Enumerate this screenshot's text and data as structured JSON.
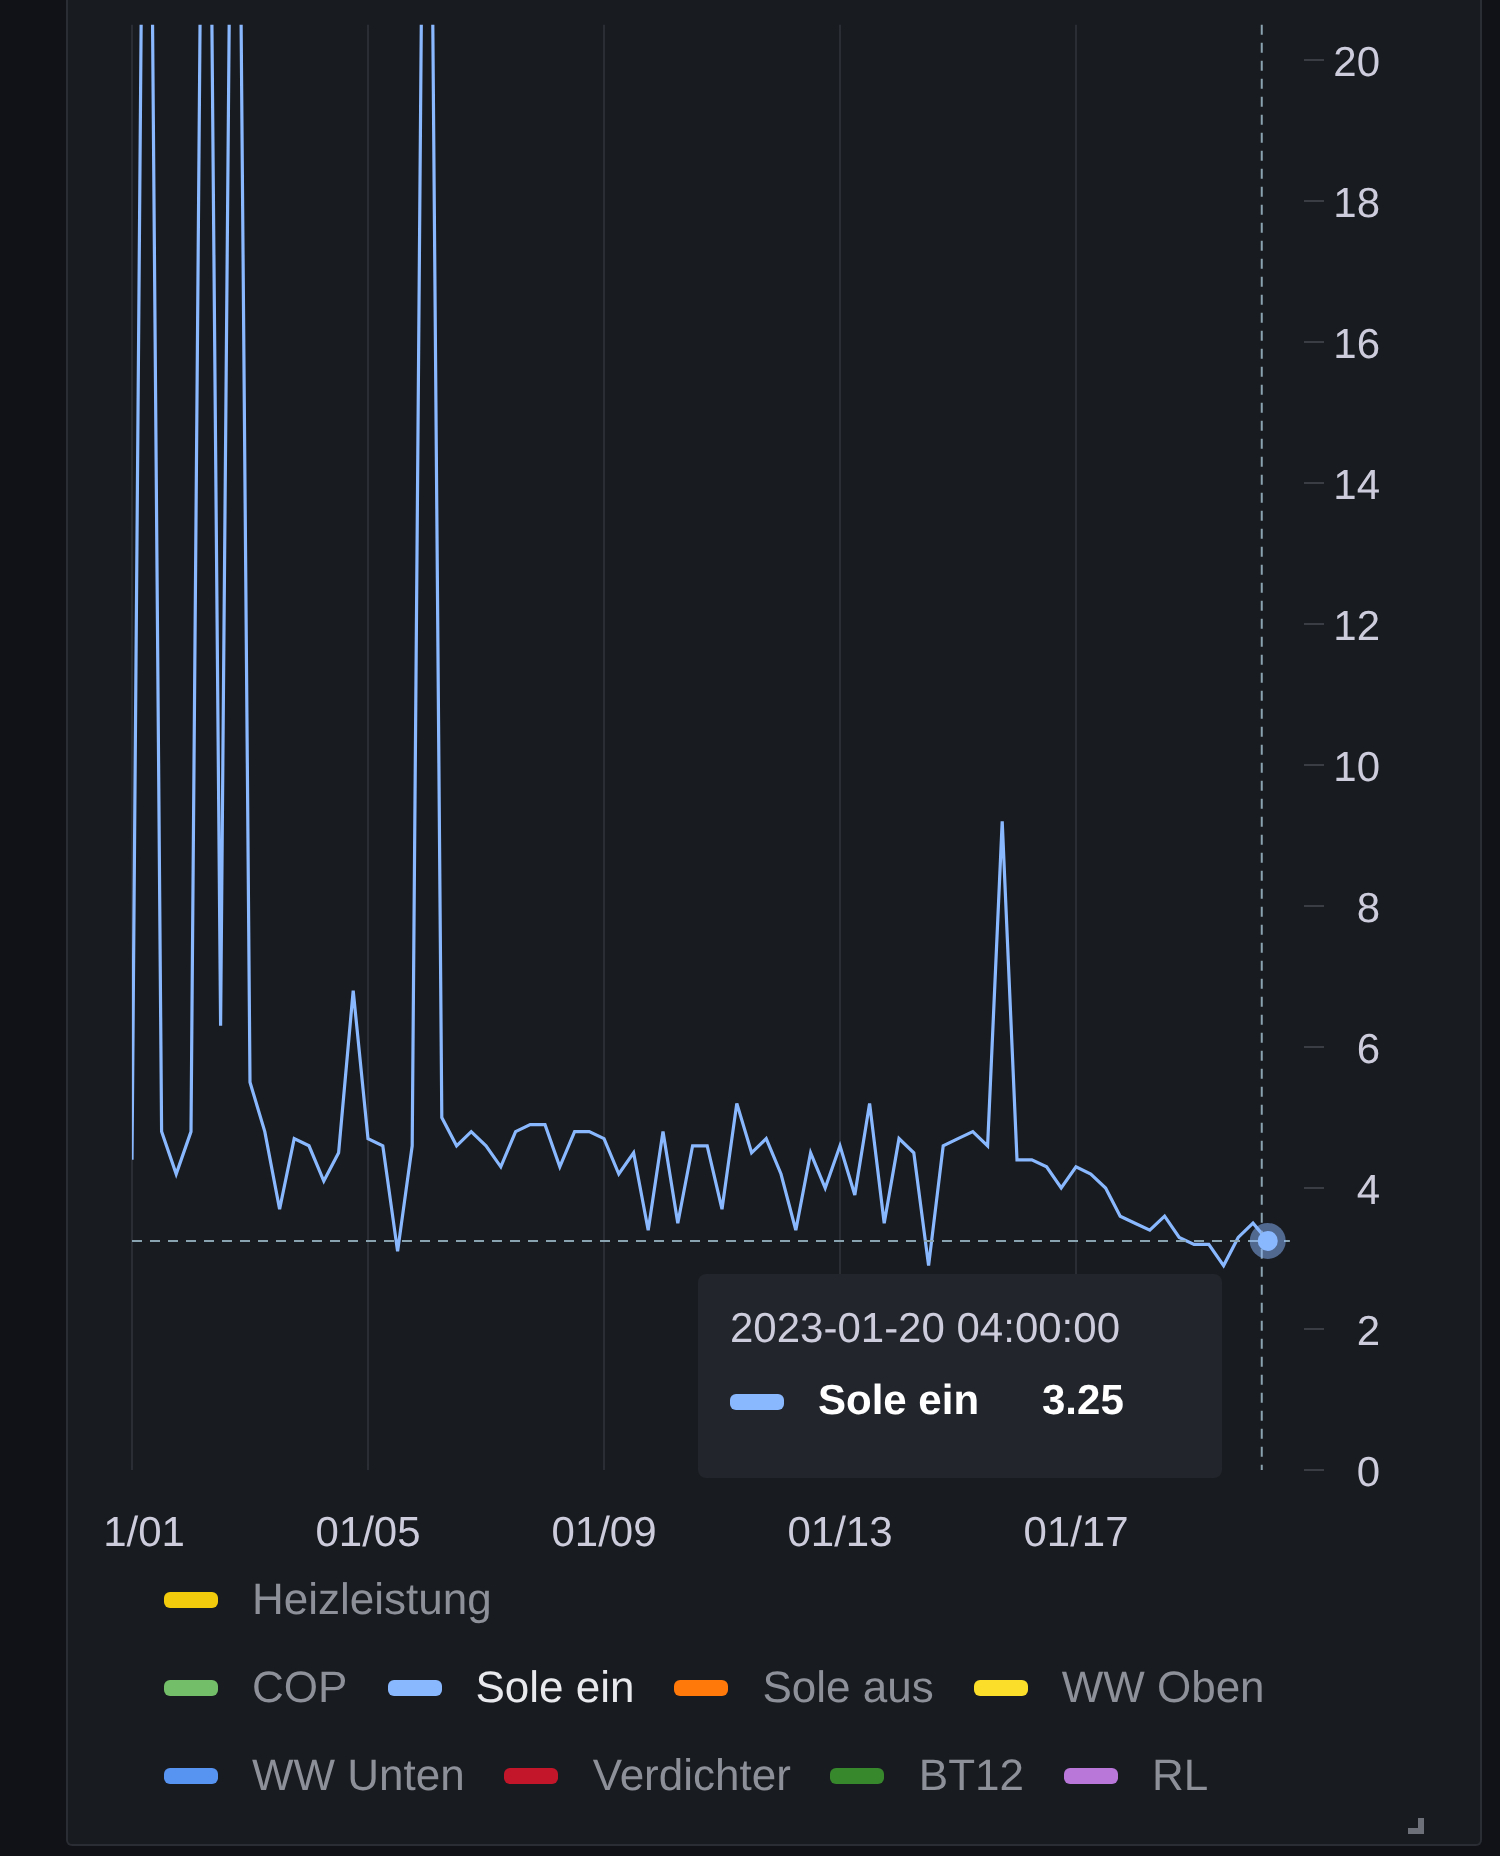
{
  "chart_data": {
    "type": "line",
    "categories": [
      "1/01",
      null,
      null,
      null,
      null,
      null,
      null,
      null,
      null,
      null,
      null,
      null,
      null,
      null,
      null,
      null,
      "01/05",
      null,
      null,
      null,
      null,
      null,
      null,
      null,
      null,
      null,
      null,
      null,
      null,
      null,
      null,
      null,
      "01/09",
      null,
      null,
      null,
      null,
      null,
      null,
      null,
      null,
      null,
      null,
      null,
      null,
      null,
      null,
      null,
      "01/13",
      null,
      null,
      null,
      null,
      null,
      null,
      null,
      null,
      null,
      null,
      null,
      null,
      null,
      null,
      null,
      "01/17",
      null,
      null,
      null,
      null,
      null,
      null,
      null,
      null,
      null,
      null,
      null,
      null,
      null
    ],
    "series": [
      {
        "name": "Sole ein",
        "color": "#8ab8ff",
        "values": [
          4.4,
          null,
          4.8,
          4.2,
          4.8,
          null,
          6.3,
          null,
          5.5,
          4.8,
          3.7,
          4.7,
          4.6,
          4.1,
          4.5,
          6.8,
          4.7,
          4.6,
          3.1,
          4.6,
          null,
          5.0,
          4.6,
          4.8,
          4.6,
          4.3,
          4.8,
          4.9,
          4.9,
          4.3,
          4.8,
          4.8,
          4.7,
          4.2,
          4.5,
          3.4,
          4.8,
          3.5,
          4.6,
          4.6,
          3.7,
          5.2,
          4.5,
          4.7,
          4.2,
          3.4,
          4.5,
          4.0,
          4.6,
          3.9,
          5.2,
          3.5,
          4.7,
          4.5,
          2.9,
          4.6,
          4.7,
          4.8,
          4.6,
          9.2,
          4.4,
          4.4,
          4.3,
          4.0,
          4.3,
          4.2,
          4.0,
          3.6,
          3.5,
          3.4,
          3.6,
          3.3,
          3.2,
          3.2,
          2.9,
          3.3,
          3.5,
          3.25
        ]
      }
    ],
    "grid": true,
    "ref_lines": [
      {
        "axis": "y",
        "value": 3.25
      }
    ],
    "ylim": [
      0,
      20.5
    ],
    "yticks": [
      0,
      2,
      4,
      6,
      8,
      10,
      12,
      14,
      16,
      18,
      20
    ]
  },
  "tooltip": {
    "time": "2023-01-20 04:00:00",
    "value": "3.25"
  },
  "legend": [
    {
      "items": [
        {
          "name": "Heizleistung",
          "color": "#f2cc0c",
          "selected": false
        }
      ]
    },
    {
      "items": [
        {
          "name": "COP",
          "color": "#73bf69",
          "selected": false
        },
        {
          "name": "Sole ein",
          "color": "#8ab8ff",
          "selected": true
        },
        {
          "name": "Sole aus",
          "color": "#ff780a",
          "selected": false
        },
        {
          "name": "WW Oben",
          "color": "#fade2a",
          "selected": false
        }
      ]
    },
    {
      "items": [
        {
          "name": "WW Unten",
          "color": "#5794f2",
          "selected": false
        },
        {
          "name": "Verdichter",
          "color": "#c4162a",
          "selected": false
        },
        {
          "name": "BT12",
          "color": "#37872d",
          "selected": false
        },
        {
          "name": "RL",
          "color": "#b877d9",
          "selected": false
        }
      ]
    }
  ]
}
